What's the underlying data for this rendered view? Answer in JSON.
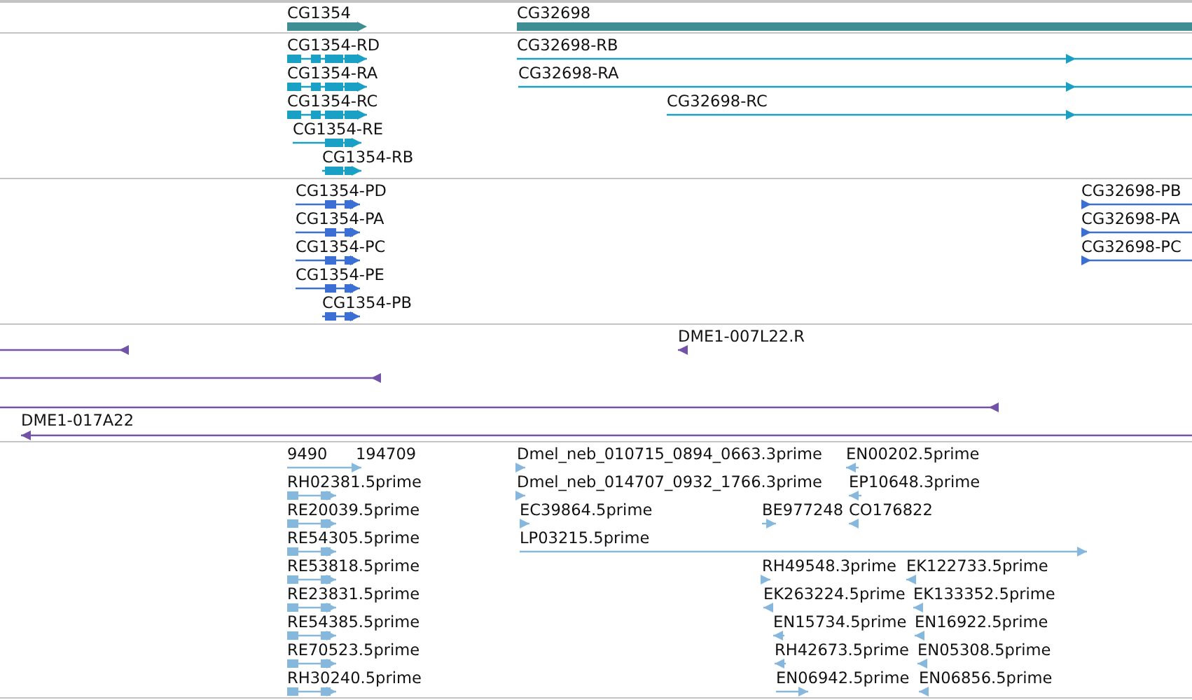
{
  "tracks": [
    {
      "kind": "gene",
      "features": [
        {
          "label": "CG1354",
          "reverse": false
        },
        {
          "label": "CG32698"
        }
      ]
    },
    {
      "kind": "transcript",
      "features": [
        {
          "label": "CG1354-RD",
          "reverse": false
        },
        {
          "label": "CG1354-RA",
          "reverse": false
        },
        {
          "label": "CG1354-RC",
          "reverse": false
        },
        {
          "label": "CG1354-RE",
          "reverse": false
        },
        {
          "label": "CG1354-RB",
          "reverse": false
        },
        {
          "label": "CG32698-RB",
          "reverse": false
        },
        {
          "label": "CG32698-RA",
          "reverse": false
        },
        {
          "label": "CG32698-RC",
          "reverse": false
        }
      ]
    },
    {
      "kind": "protein",
      "features": [
        {
          "label": "CG1354-PD",
          "reverse": false
        },
        {
          "label": "CG1354-PA",
          "reverse": false
        },
        {
          "label": "CG1354-PC",
          "reverse": false
        },
        {
          "label": "CG1354-PE",
          "reverse": false
        },
        {
          "label": "CG1354-PB",
          "reverse": false
        },
        {
          "label": "CG32698-PB",
          "reverse": false
        },
        {
          "label": "CG32698-PA",
          "reverse": false
        },
        {
          "label": "CG32698-PC",
          "reverse": false
        }
      ]
    },
    {
      "kind": "clone",
      "features": [
        {
          "reverse": true
        },
        {
          "reverse": true
        },
        {
          "label": "DME1-007L22.R",
          "reverse": true
        },
        {
          "reverse": true
        },
        {
          "label": "DME1-017A22",
          "reverse": true
        }
      ]
    },
    {
      "kind": "est",
      "features": [
        {
          "label": "9490",
          "reverse": false
        },
        {
          "label": "194709"
        },
        {
          "label": "RH02381.5prime",
          "reverse": false
        },
        {
          "label": "RE20039.5prime",
          "reverse": false
        },
        {
          "label": "RE54305.5prime",
          "reverse": false
        },
        {
          "label": "RE53818.5prime",
          "reverse": false
        },
        {
          "label": "RE23831.5prime",
          "reverse": false
        },
        {
          "label": "RE54385.5prime",
          "reverse": false
        },
        {
          "label": "RE70523.5prime",
          "reverse": false
        },
        {
          "label": "RH30240.5prime",
          "reverse": false
        },
        {
          "label": "Dmel_neb_010715_0894_0663.3prime",
          "reverse": false
        },
        {
          "label": "EN00202.5prime",
          "reverse": true
        },
        {
          "label": "Dmel_neb_014707_0932_1766.3prime",
          "reverse": false
        },
        {
          "label": "EP10648.3prime",
          "reverse": true
        },
        {
          "label": "EC39864.5prime",
          "reverse": false
        },
        {
          "label": "BE977248",
          "reverse": false
        },
        {
          "label": "CO176822",
          "reverse": true
        },
        {
          "label": "LP03215.5prime",
          "reverse": false
        },
        {
          "label": "RH49548.3prime",
          "reverse": false
        },
        {
          "label": "EK122733.5prime",
          "reverse": true
        },
        {
          "label": "EK263224.5prime",
          "reverse": true
        },
        {
          "label": "EK133352.5prime",
          "reverse": true
        },
        {
          "label": "EN15734.5prime",
          "reverse": true
        },
        {
          "label": "EN16922.5prime",
          "reverse": true
        },
        {
          "label": "RH42673.5prime",
          "reverse": true
        },
        {
          "label": "EN05308.5prime",
          "reverse": true
        },
        {
          "label": "EN06942.5prime",
          "reverse": false
        },
        {
          "label": "EN06856.5prime",
          "reverse": true
        }
      ]
    }
  ]
}
